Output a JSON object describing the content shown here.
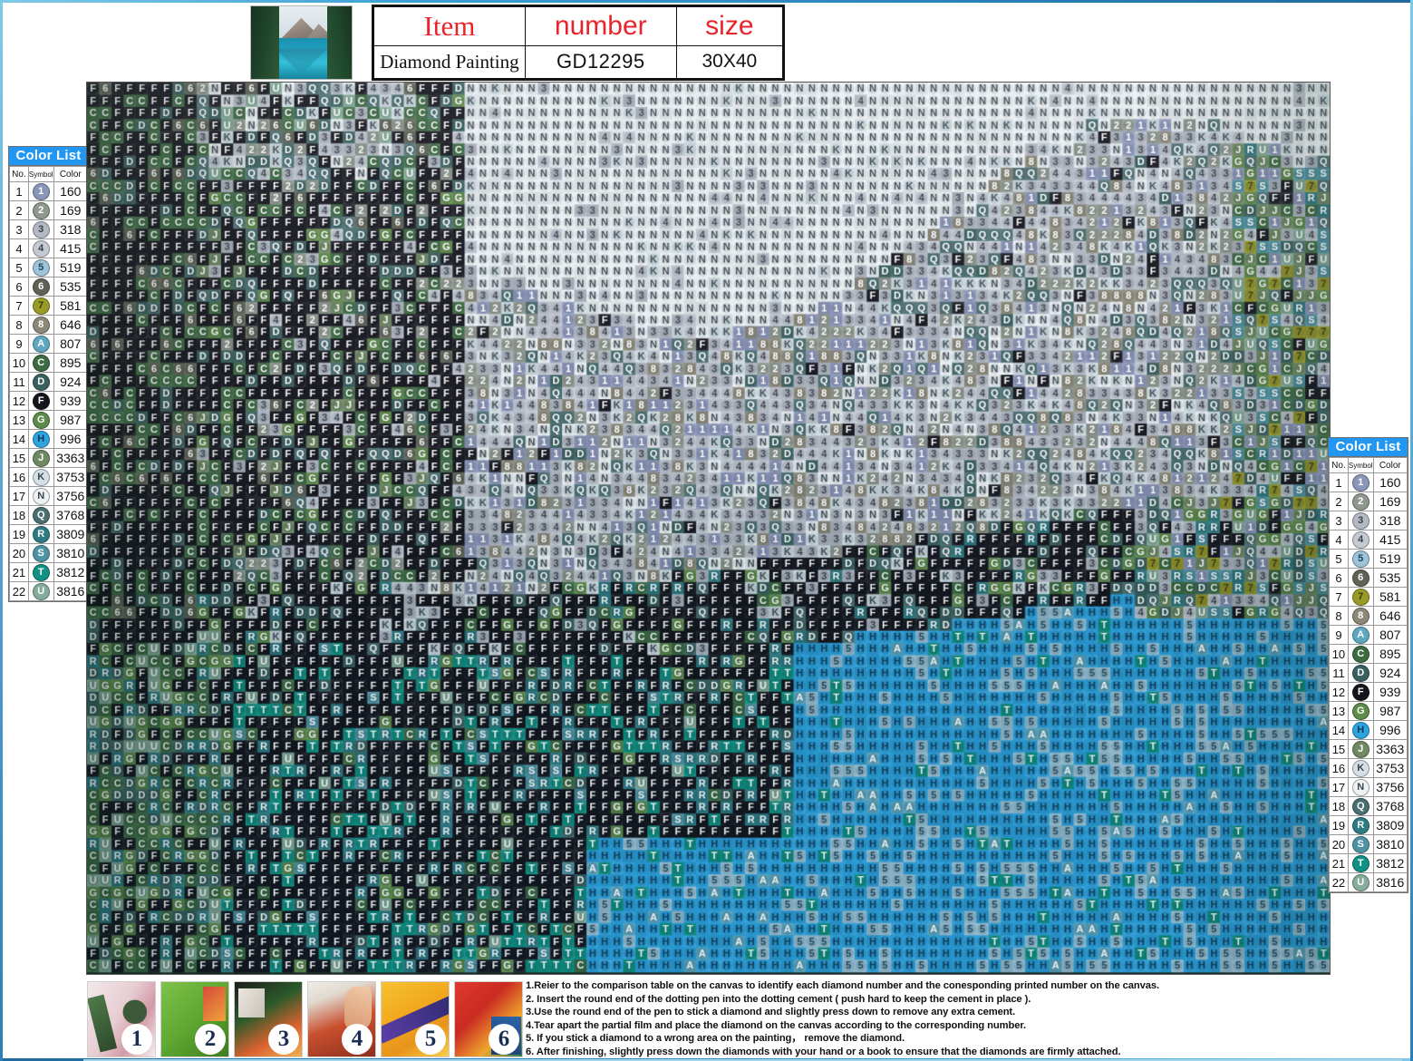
{
  "header": {
    "thumbnail_alt": "mountain-lake-preview",
    "table": {
      "columns": [
        "Item",
        "number",
        "size"
      ],
      "values": [
        "Diamond Painting",
        "GD12295",
        "30X40"
      ]
    }
  },
  "color_list": {
    "title": "Color List",
    "columns": [
      "No.",
      "Symbol",
      "Color"
    ],
    "rows": [
      {
        "no": "1",
        "symbol": "1",
        "code": "160",
        "swatch": "#8b95ba",
        "fg": "#ffffff"
      },
      {
        "no": "2",
        "symbol": "2",
        "code": "169",
        "swatch": "#8f978e",
        "fg": "#ffffff"
      },
      {
        "no": "3",
        "symbol": "3",
        "code": "318",
        "swatch": "#b2b8c4",
        "fg": "#3a3f48"
      },
      {
        "no": "4",
        "symbol": "4",
        "code": "415",
        "swatch": "#c4cad4",
        "fg": "#3a3f48"
      },
      {
        "no": "5",
        "symbol": "5",
        "code": "519",
        "swatch": "#9cc3d8",
        "fg": "#24455a"
      },
      {
        "no": "6",
        "symbol": "6",
        "code": "535",
        "swatch": "#5f6355",
        "fg": "#ffffff"
      },
      {
        "no": "7",
        "symbol": "7",
        "code": "581",
        "swatch": "#9a9a27",
        "fg": "#3a3a10"
      },
      {
        "no": "8",
        "symbol": "8",
        "code": "646",
        "swatch": "#8b8878",
        "fg": "#ffffff"
      },
      {
        "no": "9",
        "symbol": "A",
        "code": "807",
        "swatch": "#5fa7bf",
        "fg": "#ffffff"
      },
      {
        "no": "10",
        "symbol": "C",
        "code": "895",
        "swatch": "#3d6b42",
        "fg": "#ffffff"
      },
      {
        "no": "11",
        "symbol": "D",
        "code": "924",
        "swatch": "#3a6160",
        "fg": "#ffffff"
      },
      {
        "no": "12",
        "symbol": "F",
        "code": "939",
        "swatch": "#14141c",
        "fg": "#ffffff"
      },
      {
        "no": "13",
        "symbol": "G",
        "code": "987",
        "swatch": "#5e8a4a",
        "fg": "#ffffff"
      },
      {
        "no": "14",
        "symbol": "H",
        "code": "996",
        "swatch": "#2da3e0",
        "fg": "#113b57"
      },
      {
        "no": "15",
        "symbol": "J",
        "code": "3363",
        "swatch": "#6f8a63",
        "fg": "#ffffff"
      },
      {
        "no": "16",
        "symbol": "K",
        "code": "3753",
        "swatch": "#d3e0e6",
        "fg": "#3a4650"
      },
      {
        "no": "17",
        "symbol": "N",
        "code": "3756",
        "swatch": "#edf2f4",
        "fg": "#3a4650"
      },
      {
        "no": "18",
        "symbol": "Q",
        "code": "3768",
        "swatch": "#4a6f72",
        "fg": "#ffffff"
      },
      {
        "no": "19",
        "symbol": "R",
        "code": "3809",
        "swatch": "#2e7b84",
        "fg": "#ffffff"
      },
      {
        "no": "20",
        "symbol": "S",
        "code": "3810",
        "swatch": "#4e93a3",
        "fg": "#ffffff"
      },
      {
        "no": "21",
        "symbol": "T",
        "code": "3812",
        "swatch": "#109183",
        "fg": "#ffffff"
      },
      {
        "no": "22",
        "symbol": "U",
        "code": "3816",
        "swatch": "#86ad9b",
        "fg": "#ffffff"
      }
    ]
  },
  "steps": [
    {
      "number": "1",
      "alt": "applying-wax-to-pen"
    },
    {
      "number": "2",
      "alt": "pen-in-tray-of-drills"
    },
    {
      "number": "3",
      "alt": "partially-finished-canvas"
    },
    {
      "number": "4",
      "alt": "placing-diamond-on-canvas"
    },
    {
      "number": "5",
      "alt": "peeling-protective-film"
    },
    {
      "number": "6",
      "alt": "completed-diamond-painting"
    }
  ],
  "instructions": [
    "1.Reier to the comparison table on the canvas to identify each diamond number and the conesponding printed number on the canvas.",
    "2. Insert the round end of the dotting pen into the dotting cement ( push hard to keep the cement in place ).",
    "3.Use the round end of the pen to stick a diamond and slightly press down to remove any extra cement.",
    "4.Tear apart the partial film and place the diamond on the canvas according to the corresponding number.",
    "5. If you stick a diamond to a wrong area on the painting， remove the diamond.",
    "6. After finishing, slightly press down the diamonds with your hand or a book to ensure that the diamonds are firmly attached."
  ],
  "grid": {
    "cols": 102,
    "rows": 73,
    "cell": 13.46,
    "description": "diamond-painting-symbol-chart-mountain-lake",
    "regions": [
      {
        "name": "sky",
        "symbols": [
          "N",
          "K",
          "4",
          "3"
        ],
        "colors": [
          "#edf2f4",
          "#d3e0e6",
          "#c4cad4"
        ]
      },
      {
        "name": "mountain",
        "symbols": [
          "1",
          "2",
          "3",
          "4",
          "Q",
          "K",
          "8"
        ],
        "colors": [
          "#b2b8c4",
          "#8b95ba",
          "#c4cad4",
          "#4a6f72"
        ]
      },
      {
        "name": "trees",
        "symbols": [
          "F",
          "C",
          "D",
          "G",
          "J",
          "6"
        ],
        "colors": [
          "#14141c",
          "#3d6b42",
          "#3a6160",
          "#5e8a4a"
        ]
      },
      {
        "name": "lake-dark",
        "symbols": [
          "F",
          "T",
          "R",
          "D",
          "S"
        ],
        "colors": [
          "#14141c",
          "#109183",
          "#2e7b84",
          "#3a6160"
        ]
      },
      {
        "name": "lake-bright",
        "symbols": [
          "H",
          "5",
          "A"
        ],
        "colors": [
          "#2da3e0",
          "#9cc3d8",
          "#5fa7bf"
        ]
      },
      {
        "name": "shore",
        "symbols": [
          "U",
          "G",
          "C",
          "7",
          "J"
        ],
        "colors": [
          "#86ad9b",
          "#5e8a4a",
          "#9a9a27"
        ]
      }
    ]
  }
}
